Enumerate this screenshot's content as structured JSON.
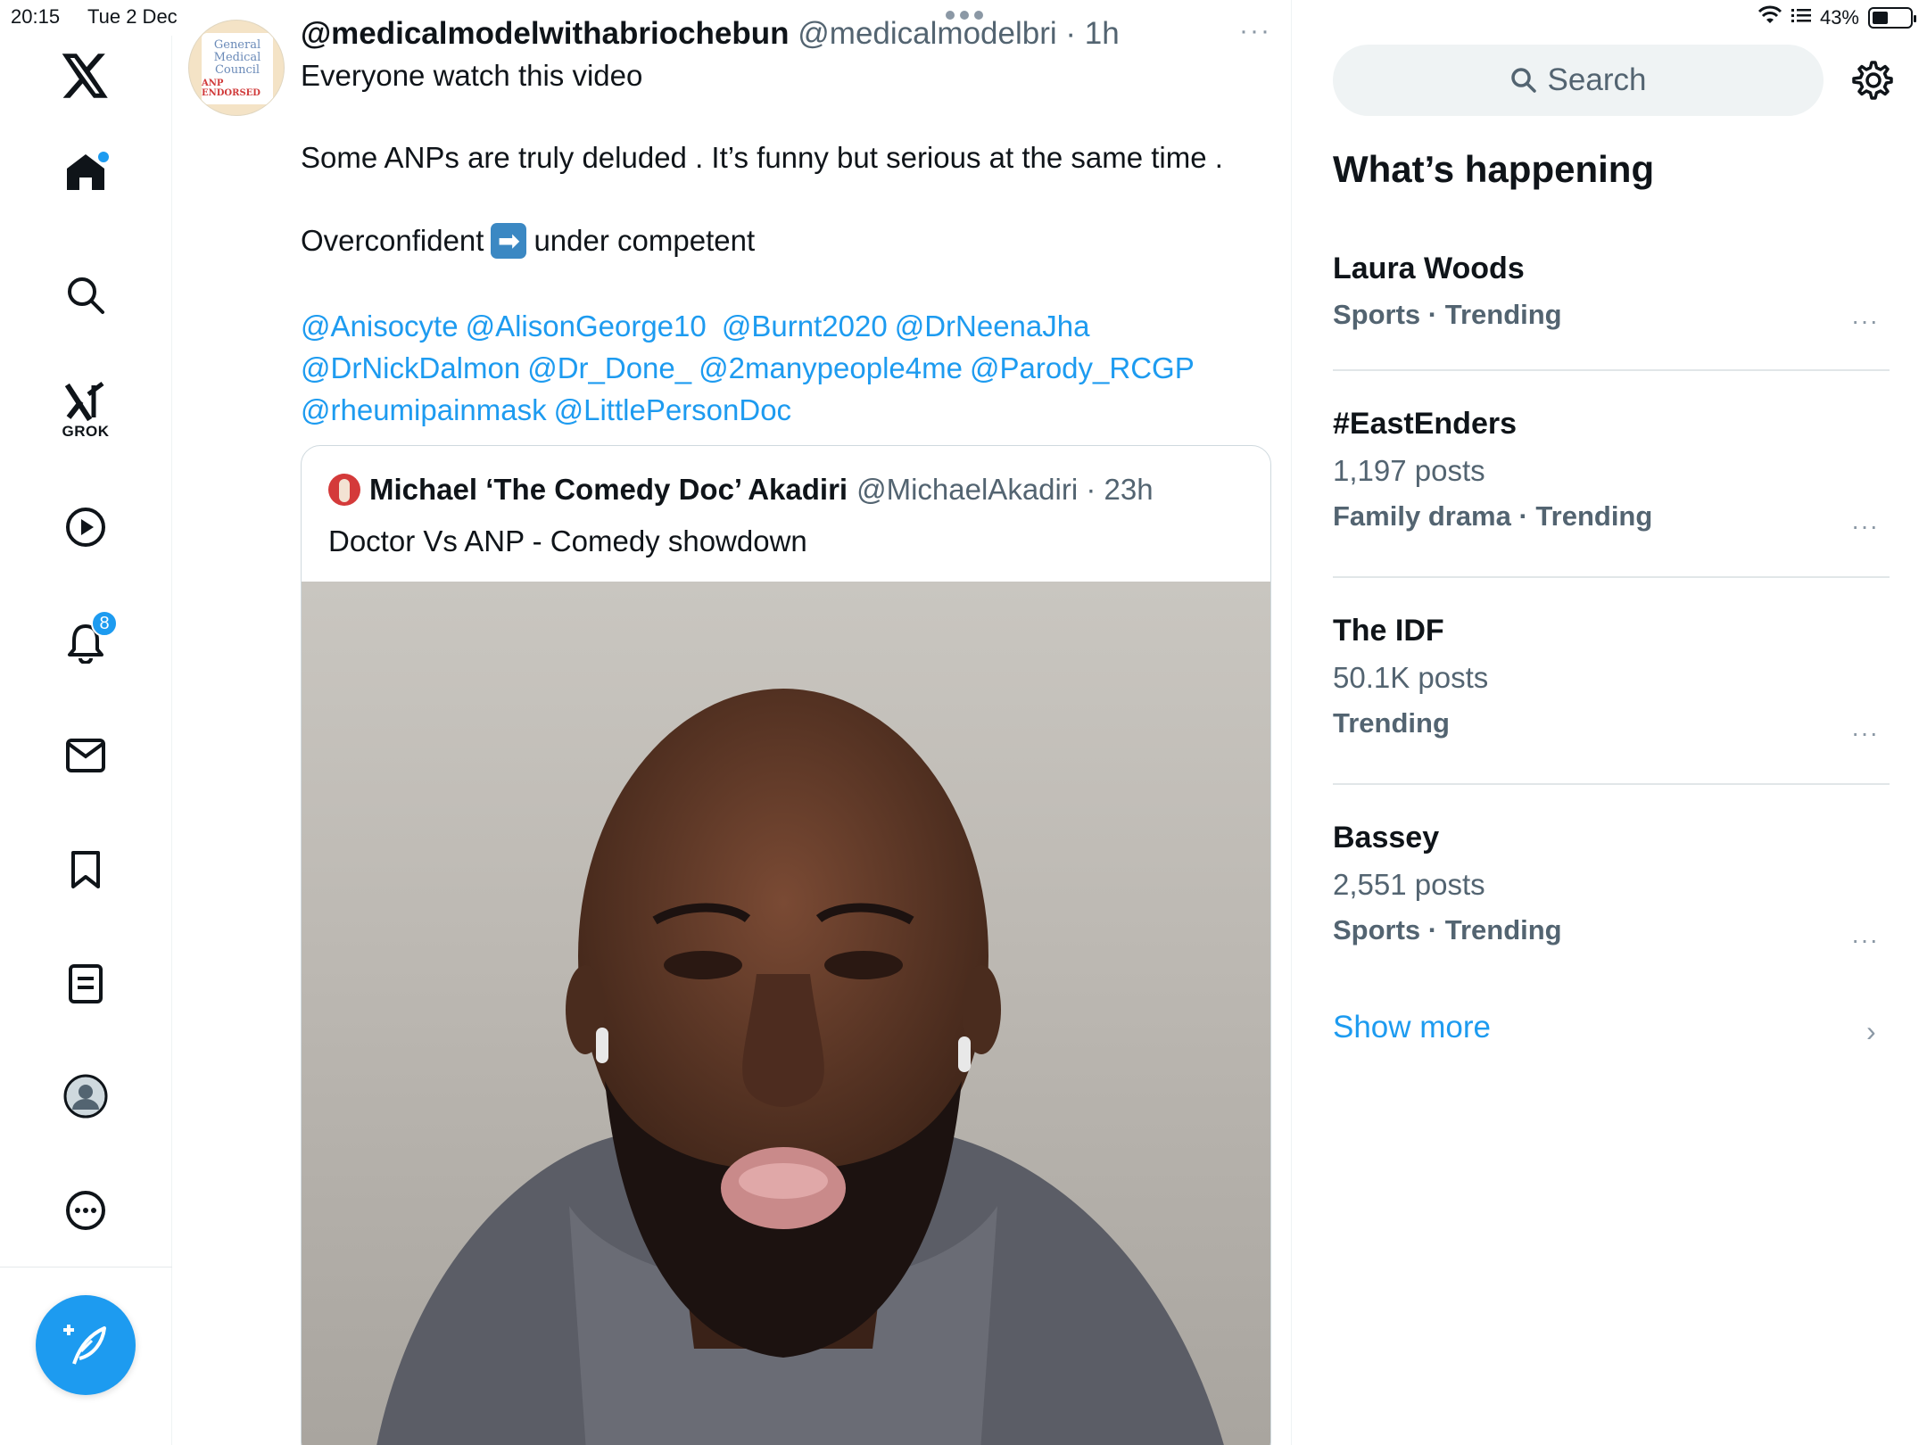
{
  "status_bar": {
    "time": "20:15",
    "date": "Tue 2 Dec",
    "battery_text": "43%",
    "battery_level": 0.43
  },
  "nav": {
    "items": [
      "logo",
      "home",
      "explore",
      "grok",
      "videos",
      "notifications",
      "messages",
      "bookmarks",
      "lists",
      "profile",
      "more"
    ],
    "grok_label": "GROK",
    "notifications_count": "8"
  },
  "tweet": {
    "display_name": "@medicalmodelwithabriochebun",
    "handle_time": "@medicalmodelbri · 1h",
    "more_label": "···",
    "line1": "Everyone watch this video",
    "line2": "Some ANPs are truly deluded . It’s funny but serious at the same time .",
    "line3_before": "Overconfident",
    "line3_emoji": "➡",
    "line3_after": "under competent",
    "mentions": [
      "@Anisocyte",
      "@AlisonGeorge10",
      "@Burnt2020",
      "@DrNeenaJha",
      "@DrNickDalmon",
      "@Dr_Done_",
      "@2manypeople4me",
      "@Parody_RCGP",
      "@rheumipainmask",
      "@LittlePersonDoc"
    ],
    "avatar_text": [
      "General",
      "Medical",
      "Council"
    ],
    "avatar_sub": "ANP ENDORSED"
  },
  "quote": {
    "display_name": "Michael ‘The Comedy Doc’ Akadiri",
    "handle_time": "@MichaelAkadiri · 23h",
    "text": "Doctor Vs ANP - Comedy showdown"
  },
  "sidebar": {
    "search_placeholder": "Search",
    "title": "What’s happening",
    "trends": [
      {
        "name": "Laura Woods",
        "posts": "",
        "category": "Sports · Trending"
      },
      {
        "name": "#EastEnders",
        "posts": "1,197 posts",
        "category": "Family drama · Trending"
      },
      {
        "name": "The IDF",
        "posts": "50.1K posts",
        "category": "Trending"
      },
      {
        "name": "Bassey",
        "posts": "2,551 posts",
        "category": "Sports · Trending"
      }
    ],
    "trend_more_label": "···",
    "show_more": "Show more",
    "show_more_chevron": "›"
  },
  "colors": {
    "accent": "#1d9bf0",
    "text": "#0f1419",
    "secondary": "#536471"
  }
}
